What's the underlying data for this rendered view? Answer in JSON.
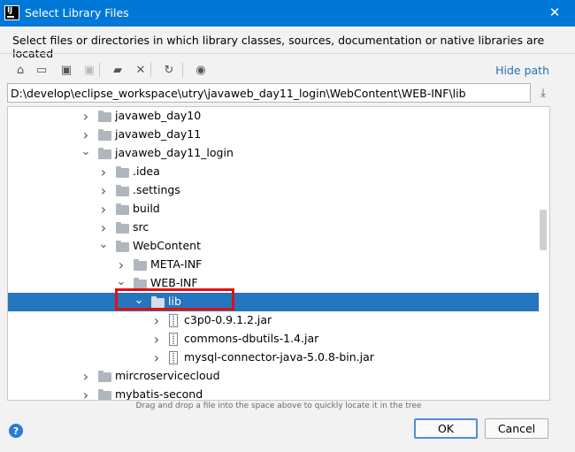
{
  "window": {
    "title": "Select Library Files",
    "app_icon_text": "IJ",
    "close_glyph": "✕"
  },
  "description": "Select files or directories in which library classes, sources, documentation or native libraries are located",
  "toolbar": {
    "buttons": [
      {
        "name": "home-icon",
        "glyph": "⌂",
        "enabled": true
      },
      {
        "name": "desktop-icon",
        "glyph": "▭",
        "enabled": true
      },
      {
        "name": "project-icon",
        "glyph": "▣",
        "enabled": true
      },
      {
        "name": "module-icon",
        "glyph": "▣",
        "enabled": false
      },
      {
        "name": "new-folder-icon",
        "glyph": "▰",
        "enabled": true
      },
      {
        "name": "delete-icon",
        "glyph": "✕",
        "enabled": true
      },
      {
        "name": "refresh-icon",
        "glyph": "↻",
        "enabled": true
      },
      {
        "name": "show-hidden-icon",
        "glyph": "◉",
        "enabled": true
      }
    ],
    "hide_path_label": "Hide path"
  },
  "path": {
    "value": "D:\\develop\\eclipse_workspace\\utry\\javaweb_day11_login\\WebContent\\WEB-INF\\lib"
  },
  "tree": {
    "items": [
      {
        "label": "javaweb_day10",
        "depth": 0,
        "type": "folder",
        "expanded": false,
        "selected": false
      },
      {
        "label": "javaweb_day11",
        "depth": 0,
        "type": "folder",
        "expanded": false,
        "selected": false
      },
      {
        "label": "javaweb_day11_login",
        "depth": 0,
        "type": "folder",
        "expanded": true,
        "selected": false
      },
      {
        "label": ".idea",
        "depth": 1,
        "type": "folder",
        "expanded": false,
        "selected": false
      },
      {
        "label": ".settings",
        "depth": 1,
        "type": "folder",
        "expanded": false,
        "selected": false
      },
      {
        "label": "build",
        "depth": 1,
        "type": "folder",
        "expanded": false,
        "selected": false
      },
      {
        "label": "src",
        "depth": 1,
        "type": "folder",
        "expanded": false,
        "selected": false
      },
      {
        "label": "WebContent",
        "depth": 1,
        "type": "folder",
        "expanded": true,
        "selected": false
      },
      {
        "label": "META-INF",
        "depth": 2,
        "type": "folder",
        "expanded": false,
        "selected": false
      },
      {
        "label": "WEB-INF",
        "depth": 2,
        "type": "folder",
        "expanded": true,
        "selected": false
      },
      {
        "label": "lib",
        "depth": 3,
        "type": "folder",
        "expanded": true,
        "selected": true
      },
      {
        "label": "c3p0-0.9.1.2.jar",
        "depth": 4,
        "type": "jar",
        "expanded": false,
        "selected": false
      },
      {
        "label": "commons-dbutils-1.4.jar",
        "depth": 4,
        "type": "jar",
        "expanded": false,
        "selected": false
      },
      {
        "label": "mysql-connector-java-5.0.8-bin.jar",
        "depth": 4,
        "type": "jar",
        "expanded": false,
        "selected": false
      },
      {
        "label": "mircroservicecloud",
        "depth": 0,
        "type": "folder",
        "expanded": false,
        "selected": false
      },
      {
        "label": "mybatis-second",
        "depth": 0,
        "type": "folder",
        "expanded": false,
        "selected": false
      }
    ]
  },
  "hint": "Drag and drop a file into the space above to quickly locate it in the tree",
  "buttons": {
    "help": "?",
    "ok": "OK",
    "cancel": "Cancel"
  },
  "colors": {
    "title_bar": "#0078d7",
    "selection": "#2675bf",
    "link": "#2470b3",
    "highlight_box": "#e01010"
  }
}
